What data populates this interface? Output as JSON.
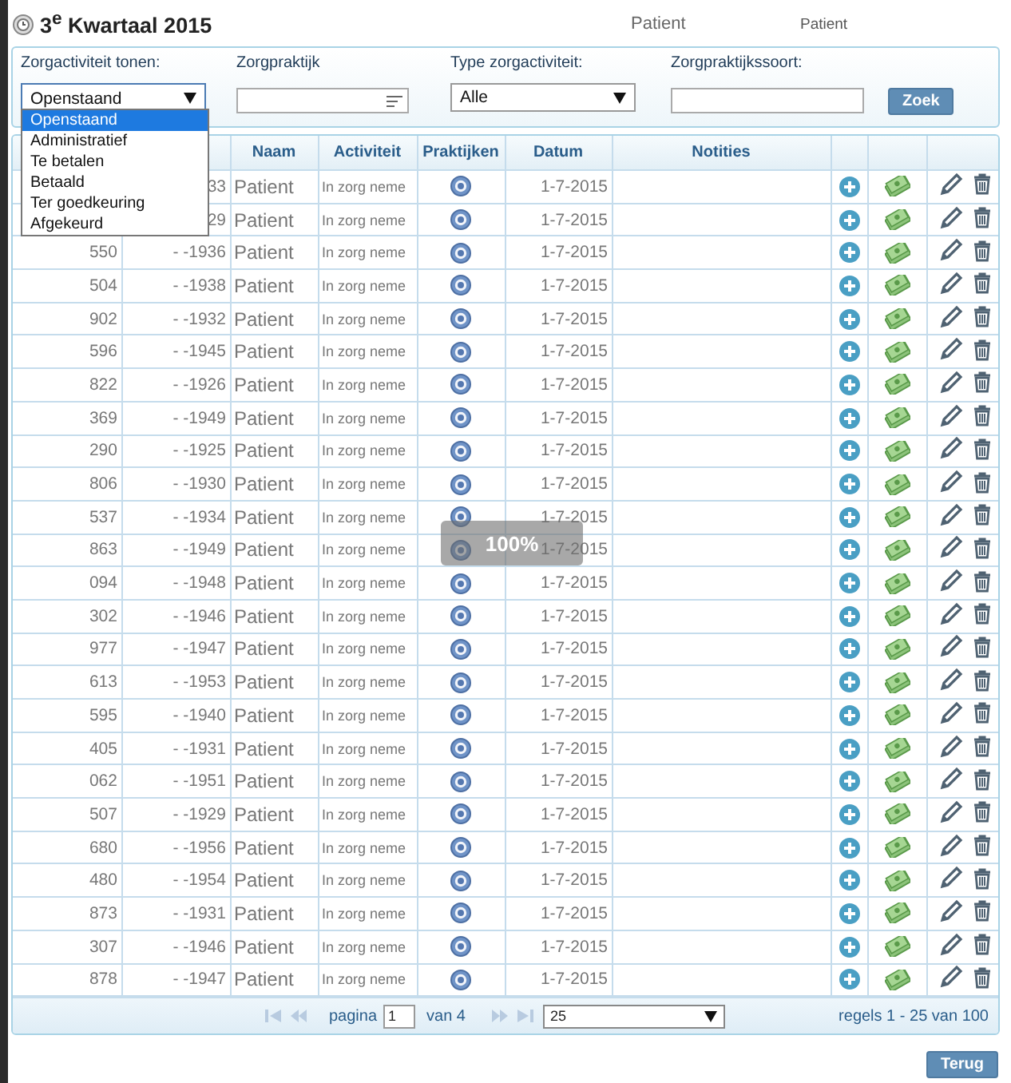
{
  "header": {
    "title": "3$^{e}$ Kwartaal 2015",
    "patient_label": "Patient",
    "patient_small": "Patient"
  },
  "filters": {
    "activity_label": "Zorgactiviteit tonen:",
    "activity_value": "Openstaand",
    "activity_options": [
      {
        "label": "Openstaand",
        "selected": true
      },
      {
        "label": "Administratief",
        "selected": false
      },
      {
        "label": "Te betalen",
        "selected": false
      },
      {
        "label": "Betaald",
        "selected": false
      },
      {
        "label": "Ter goedkeuring",
        "selected": false
      },
      {
        "label": "Afgekeurd",
        "selected": false
      }
    ],
    "practice_label": "Zorgpraktijk",
    "type_label": "Type zorgactiviteit:",
    "type_value": "Alle",
    "kind_label": "Zorgpraktijkssoort:",
    "search_button": "Zoek"
  },
  "table": {
    "columns": [
      "Naam",
      "Activiteit",
      "Praktijken",
      "Datum",
      "Notities"
    ],
    "rows": [
      {
        "column_2": "33",
        "naam": "Patient",
        "activiteit": "In zorg neme",
        "datum": "1-7-2015"
      },
      {
        "column_2": "29",
        "naam": "Patient",
        "activiteit": "In zorg neme",
        "datum": "1-7-2015"
      },
      {
        "column_1": "550",
        "column_2": "- -1936",
        "naam": "Patient",
        "activiteit": "In zorg neme",
        "datum": "1-7-2015"
      },
      {
        "column_1": "504",
        "column_2": "- -1938",
        "naam": "Patient",
        "activiteit": "In zorg neme",
        "datum": "1-7-2015"
      },
      {
        "column_1": "902",
        "column_2": "- -1932",
        "naam": "Patient",
        "activiteit": "In zorg neme",
        "datum": "1-7-2015"
      },
      {
        "column_1": "596",
        "column_2": "- -1945",
        "naam": "Patient",
        "activiteit": "In zorg neme",
        "datum": "1-7-2015"
      },
      {
        "column_1": "822",
        "column_2": "- -1926",
        "naam": "Patient",
        "activiteit": "In zorg neme",
        "datum": "1-7-2015"
      },
      {
        "column_1": "369",
        "column_2": "- -1949",
        "naam": "Patient",
        "activiteit": "In zorg neme",
        "datum": "1-7-2015"
      },
      {
        "column_1": "290",
        "column_2": "- -1925",
        "naam": "Patient",
        "activiteit": "In zorg neme",
        "datum": "1-7-2015"
      },
      {
        "column_1": "806",
        "column_2": "- -1930",
        "naam": "Patient",
        "activiteit": "In zorg neme",
        "datum": "1-7-2015"
      },
      {
        "column_1": "537",
        "column_2": "- -1934",
        "naam": "Patient",
        "activiteit": "In zorg neme",
        "datum": "1-7-2015"
      },
      {
        "column_1": "863",
        "column_2": "- -1949",
        "naam": "Patient",
        "activiteit": "In zorg neme",
        "datum": "1-7-2015"
      },
      {
        "column_1": "094",
        "column_2": "- -1948",
        "naam": "Patient",
        "activiteit": "In zorg neme",
        "datum": "1-7-2015"
      },
      {
        "column_1": "302",
        "column_2": "- -1946",
        "naam": "Patient",
        "activiteit": "In zorg neme",
        "datum": "1-7-2015"
      },
      {
        "column_1": "977",
        "column_2": "- -1947",
        "naam": "Patient",
        "activiteit": "In zorg neme",
        "datum": "1-7-2015"
      },
      {
        "column_1": "613",
        "column_2": "- -1953",
        "naam": "Patient",
        "activiteit": "In zorg neme",
        "datum": "1-7-2015"
      },
      {
        "column_1": "595",
        "column_2": "- -1940",
        "naam": "Patient",
        "activiteit": "In zorg neme",
        "datum": "1-7-2015"
      },
      {
        "column_1": "405",
        "column_2": "- -1931",
        "naam": "Patient",
        "activiteit": "In zorg neme",
        "datum": "1-7-2015"
      },
      {
        "column_1": "062",
        "column_2": "- -1951",
        "naam": "Patient",
        "activiteit": "In zorg neme",
        "datum": "1-7-2015"
      },
      {
        "column_1": "507",
        "column_2": "- -1929",
        "naam": "Patient",
        "activiteit": "In zorg neme",
        "datum": "1-7-2015"
      },
      {
        "column_1": "680",
        "column_2": "- -1956",
        "naam": "Patient",
        "activiteit": "In zorg neme",
        "datum": "1-7-2015"
      },
      {
        "column_1": "480",
        "column_2": "- -1954",
        "naam": "Patient",
        "activiteit": "In zorg neme",
        "datum": "1-7-2015"
      },
      {
        "column_1": "873",
        "column_2": "- -1931",
        "naam": "Patient",
        "activiteit": "In zorg neme",
        "datum": "1-7-2015"
      },
      {
        "column_1": "307",
        "column_2": "- -1946",
        "naam": "Patient",
        "activiteit": "In zorg neme",
        "datum": "1-7-2015"
      },
      {
        "column_1": "878",
        "column_2": "- -1947",
        "naam": "Patient",
        "activiteit": "In zorg neme",
        "datum": "1-7-2015"
      }
    ]
  },
  "loading": {
    "text": "100%"
  },
  "pager": {
    "page_label": "pagina",
    "page_value": "1",
    "of_label": "van 4",
    "page_size": "25",
    "summary": "regels 1 - 25 van 100"
  },
  "back_button": "Terug"
}
